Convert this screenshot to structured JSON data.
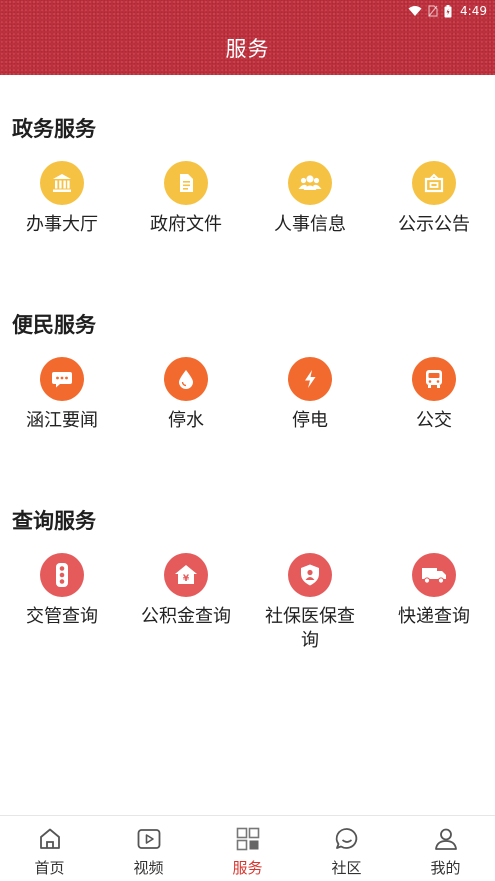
{
  "status_bar": {
    "time": "4:49"
  },
  "header": {
    "title": "服务"
  },
  "colors": {
    "header_red": "#c0323f",
    "gov_yellow": "#f6c244",
    "civil_orange": "#f26a2e",
    "query_red": "#e55b5b",
    "active_tab": "#d8362f"
  },
  "sections": [
    {
      "title": "政务服务",
      "items": [
        {
          "label": "办事大厅",
          "icon": "hall-icon"
        },
        {
          "label": "政府文件",
          "icon": "document-icon"
        },
        {
          "label": "人事信息",
          "icon": "people-icon"
        },
        {
          "label": "公示公告",
          "icon": "notice-icon"
        }
      ]
    },
    {
      "title": "便民服务",
      "items": [
        {
          "label": "涵江要闻",
          "icon": "chat-icon"
        },
        {
          "label": "停水",
          "icon": "water-drop-icon"
        },
        {
          "label": "停电",
          "icon": "lightning-icon"
        },
        {
          "label": "公交",
          "icon": "bus-icon"
        }
      ]
    },
    {
      "title": "查询服务",
      "items": [
        {
          "label": "交管查询",
          "icon": "traffic-light-icon"
        },
        {
          "label": "公积金查询",
          "icon": "housing-fund-icon"
        },
        {
          "label": "社保医保查询",
          "icon": "shield-user-icon"
        },
        {
          "label": "快递查询",
          "icon": "truck-icon"
        }
      ]
    }
  ],
  "tabbar": [
    {
      "label": "首页",
      "icon": "home-icon"
    },
    {
      "label": "视频",
      "icon": "video-icon"
    },
    {
      "label": "服务",
      "icon": "grid-icon",
      "active": true
    },
    {
      "label": "社区",
      "icon": "chat-bubble-icon"
    },
    {
      "label": "我的",
      "icon": "user-icon"
    }
  ]
}
